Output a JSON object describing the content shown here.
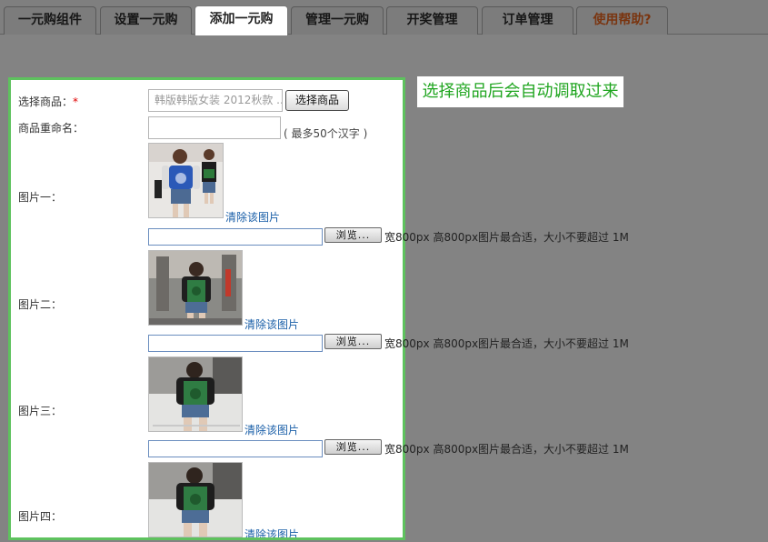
{
  "tabs": [
    {
      "label": "一元购组件"
    },
    {
      "label": "设置一元购"
    },
    {
      "label": "添加一元购"
    },
    {
      "label": "管理一元购"
    },
    {
      "label": "开奖管理"
    },
    {
      "label": "订单管理"
    },
    {
      "label": "使用帮助?"
    }
  ],
  "form": {
    "select_product_label": "选择商品：",
    "required_mark": "*",
    "select_product_value": "韩版韩版女装 2012秋款 ...",
    "select_product_button": "选择商品",
    "rename_label": "商品重命名：",
    "rename_value": "",
    "rename_hint": "( 最多50个汉字 )",
    "images": [
      {
        "label": "图片一：",
        "clear": "清除该图片",
        "browse": "浏览..."
      },
      {
        "label": "图片二：",
        "clear": "清除该图片",
        "browse": "浏览..."
      },
      {
        "label": "图片三：",
        "clear": "清除该图片",
        "browse": "浏览..."
      },
      {
        "label": "图片四：",
        "clear": "清除该图片"
      }
    ],
    "size_note": "宽800px 高800px图片最合适，大小不要超过 1M"
  },
  "tip": "选择商品后会自动调取过来",
  "colors": {
    "overlay": "#838383",
    "panel_border": "#5ec25e",
    "tip_text": "#1fa51f",
    "link": "#1a5fa8"
  }
}
